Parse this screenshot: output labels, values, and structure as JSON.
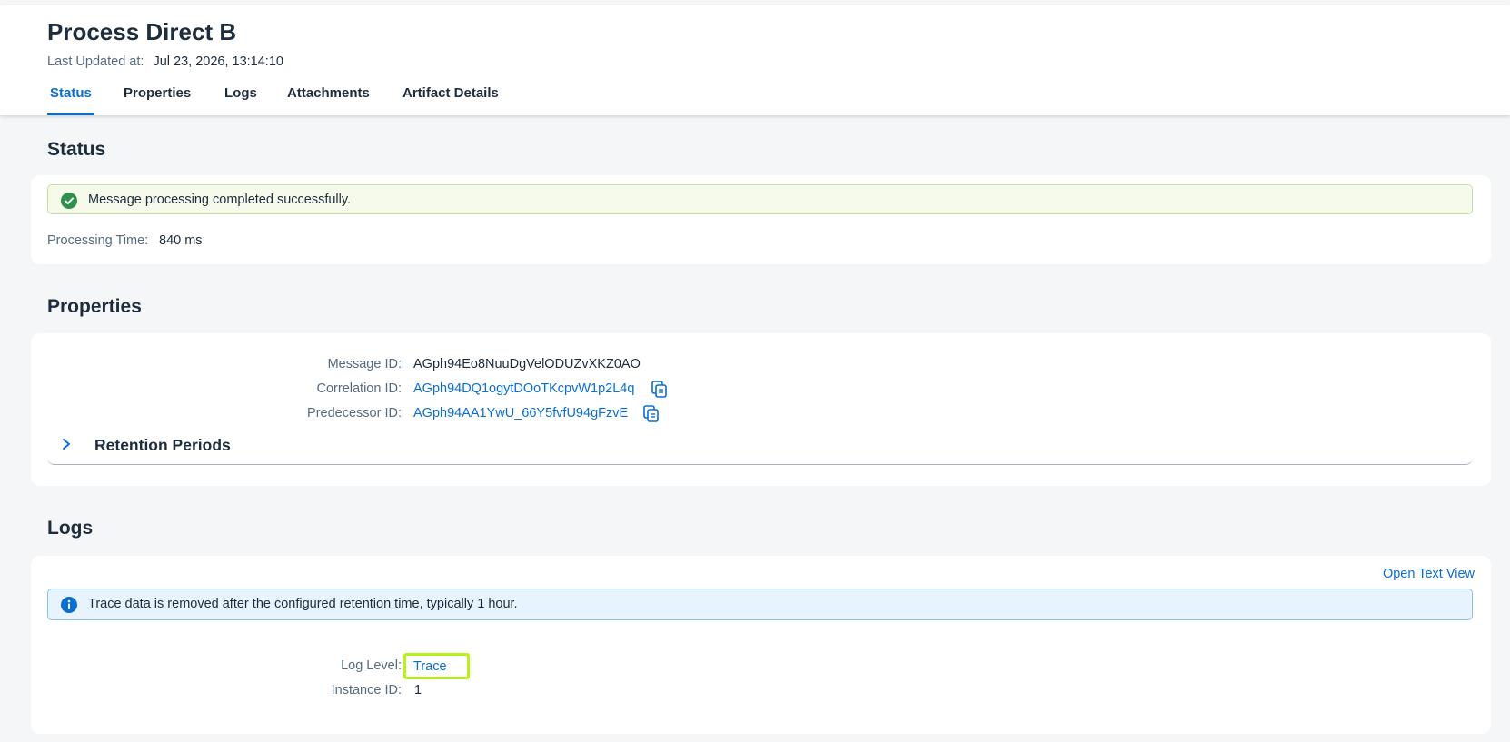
{
  "header": {
    "title": "Process Direct B",
    "last_updated_label": "Last Updated at:",
    "last_updated_value": "Jul 23, 2026, 13:14:10"
  },
  "tabs": [
    {
      "label": "Status",
      "active": true
    },
    {
      "label": "Properties",
      "active": false
    },
    {
      "label": "Logs",
      "active": false
    },
    {
      "label": "Attachments",
      "active": false
    },
    {
      "label": "Artifact Details",
      "active": false
    }
  ],
  "status": {
    "section_title": "Status",
    "message": "Message processing completed successfully.",
    "message_icon": "success-check-icon",
    "processing_time_label": "Processing Time:",
    "processing_time_value": "840 ms"
  },
  "properties": {
    "section_title": "Properties",
    "message_id_label": "Message ID:",
    "message_id_value": "AGph94Eo8NuuDgVelODUZvXKZ0AO",
    "correlation_id_label": "Correlation ID:",
    "correlation_id_value": "AGph94DQ1ogytDOoTKcpvW1p2L4q",
    "predecessor_id_label": "Predecessor ID:",
    "predecessor_id_value": "AGph94AA1YwU_66Y5fvfU94gFzvE",
    "retention_title": "Retention Periods"
  },
  "logs": {
    "section_title": "Logs",
    "open_text_view": "Open Text View",
    "info_message": "Trace data is removed after the configured retention time, typically 1 hour.",
    "info_icon": "info-icon",
    "log_level_label": "Log Level:",
    "log_level_value": "Trace",
    "instance_id_label": "Instance ID:",
    "instance_id_value": "1"
  },
  "colors": {
    "accent": "#0a6ed1",
    "success": "#30914c",
    "info": "#0a6ed1",
    "highlight": "#b9f21b"
  }
}
